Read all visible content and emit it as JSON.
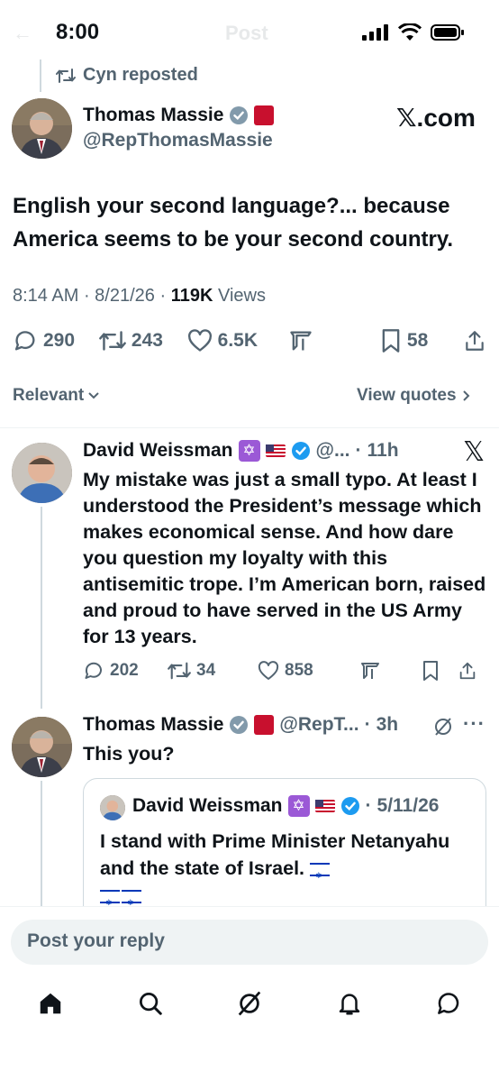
{
  "status_bar": {
    "time": "8:00",
    "title": "Post"
  },
  "repost": {
    "text": "Cyn reposted"
  },
  "main_post": {
    "author": "Thomas Massie",
    "handle": "@RepThomasMassie",
    "watermark": "𝕏.com",
    "text": "English your second language?... because America seems to be your second country.",
    "time": "8:14 AM",
    "date": "8/21/26",
    "views_count": "119K",
    "views_label": "Views",
    "replies": "290",
    "reposts": "243",
    "likes": "6.5K",
    "bookmarks": "58"
  },
  "sort": {
    "relevant": "Relevant",
    "view_quotes": "View quotes"
  },
  "reply1": {
    "author": "David Weissman",
    "handle": "@...",
    "age": "11h",
    "text": "My mistake was just a small typo. At least I understood the President’s message which makes economical sense. And how dare you question my loyalty with this antisemitic trope. I’m American born, raised and proud to have served in the US Army for 13 years.",
    "replies": "202",
    "reposts": "34",
    "likes": "858"
  },
  "reply2": {
    "author": "Thomas Massie",
    "handle": "@RepT...",
    "age": "3h",
    "text": "This you?",
    "quote": {
      "author": "David Weissman",
      "date": "5/11/26",
      "text": "I stand with Prime Minister Netanyahu and the state of Israel."
    }
  },
  "reply_box": {
    "placeholder": "Post your reply"
  },
  "colors": {
    "verified": "#1d9bf0",
    "gray": "#536471",
    "divider": "#eff3f4"
  }
}
